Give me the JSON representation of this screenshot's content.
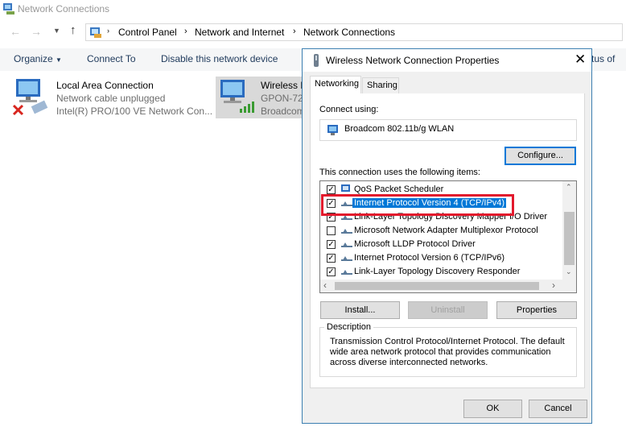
{
  "window": {
    "title": "Network Connections"
  },
  "address": {
    "crumbs": [
      "Control Panel",
      "Network and Internet",
      "Network Connections"
    ]
  },
  "commands": {
    "organize": "Organize",
    "connect_to": "Connect To",
    "disable": "Disable this network device",
    "overflow": "tus of"
  },
  "connections": [
    {
      "name": "Local Area Connection",
      "status": "Network cable unplugged",
      "device": "Intel(R) PRO/100 VE Network Con..."
    },
    {
      "name": "Wireless N",
      "status": "GPON-72",
      "device": "Broadcom"
    }
  ],
  "dialog": {
    "title": "Wireless Network Connection Properties",
    "tabs": [
      "Networking",
      "Sharing"
    ],
    "connect_using_label": "Connect using:",
    "adapter": "Broadcom 802.11b/g WLAN",
    "configure_button": "Configure...",
    "items_label": "This connection uses the following items:",
    "items": [
      {
        "label": "QoS Packet Scheduler",
        "checked": true
      },
      {
        "label": "Internet Protocol Version 4 (TCP/IPv4)",
        "checked": true
      },
      {
        "label": "Link-Layer Topology Discovery Mapper I/O Driver",
        "checked": true
      },
      {
        "label": "Microsoft Network Adapter Multiplexor Protocol",
        "checked": false
      },
      {
        "label": "Microsoft LLDP Protocol Driver",
        "checked": true
      },
      {
        "label": "Internet Protocol Version 6 (TCP/IPv6)",
        "checked": true
      },
      {
        "label": "Link-Layer Topology Discovery Responder",
        "checked": true
      }
    ],
    "install_button": "Install...",
    "uninstall_button": "Uninstall",
    "properties_button": "Properties",
    "description_label": "Description",
    "description_text": "Transmission Control Protocol/Internet Protocol. The default wide area network protocol that provides communication across diverse interconnected networks.",
    "ok_button": "OK",
    "cancel_button": "Cancel"
  },
  "colors": {
    "selection": "#0078d7",
    "highlight_box": "#e2192c",
    "command_text": "#1e395b"
  }
}
